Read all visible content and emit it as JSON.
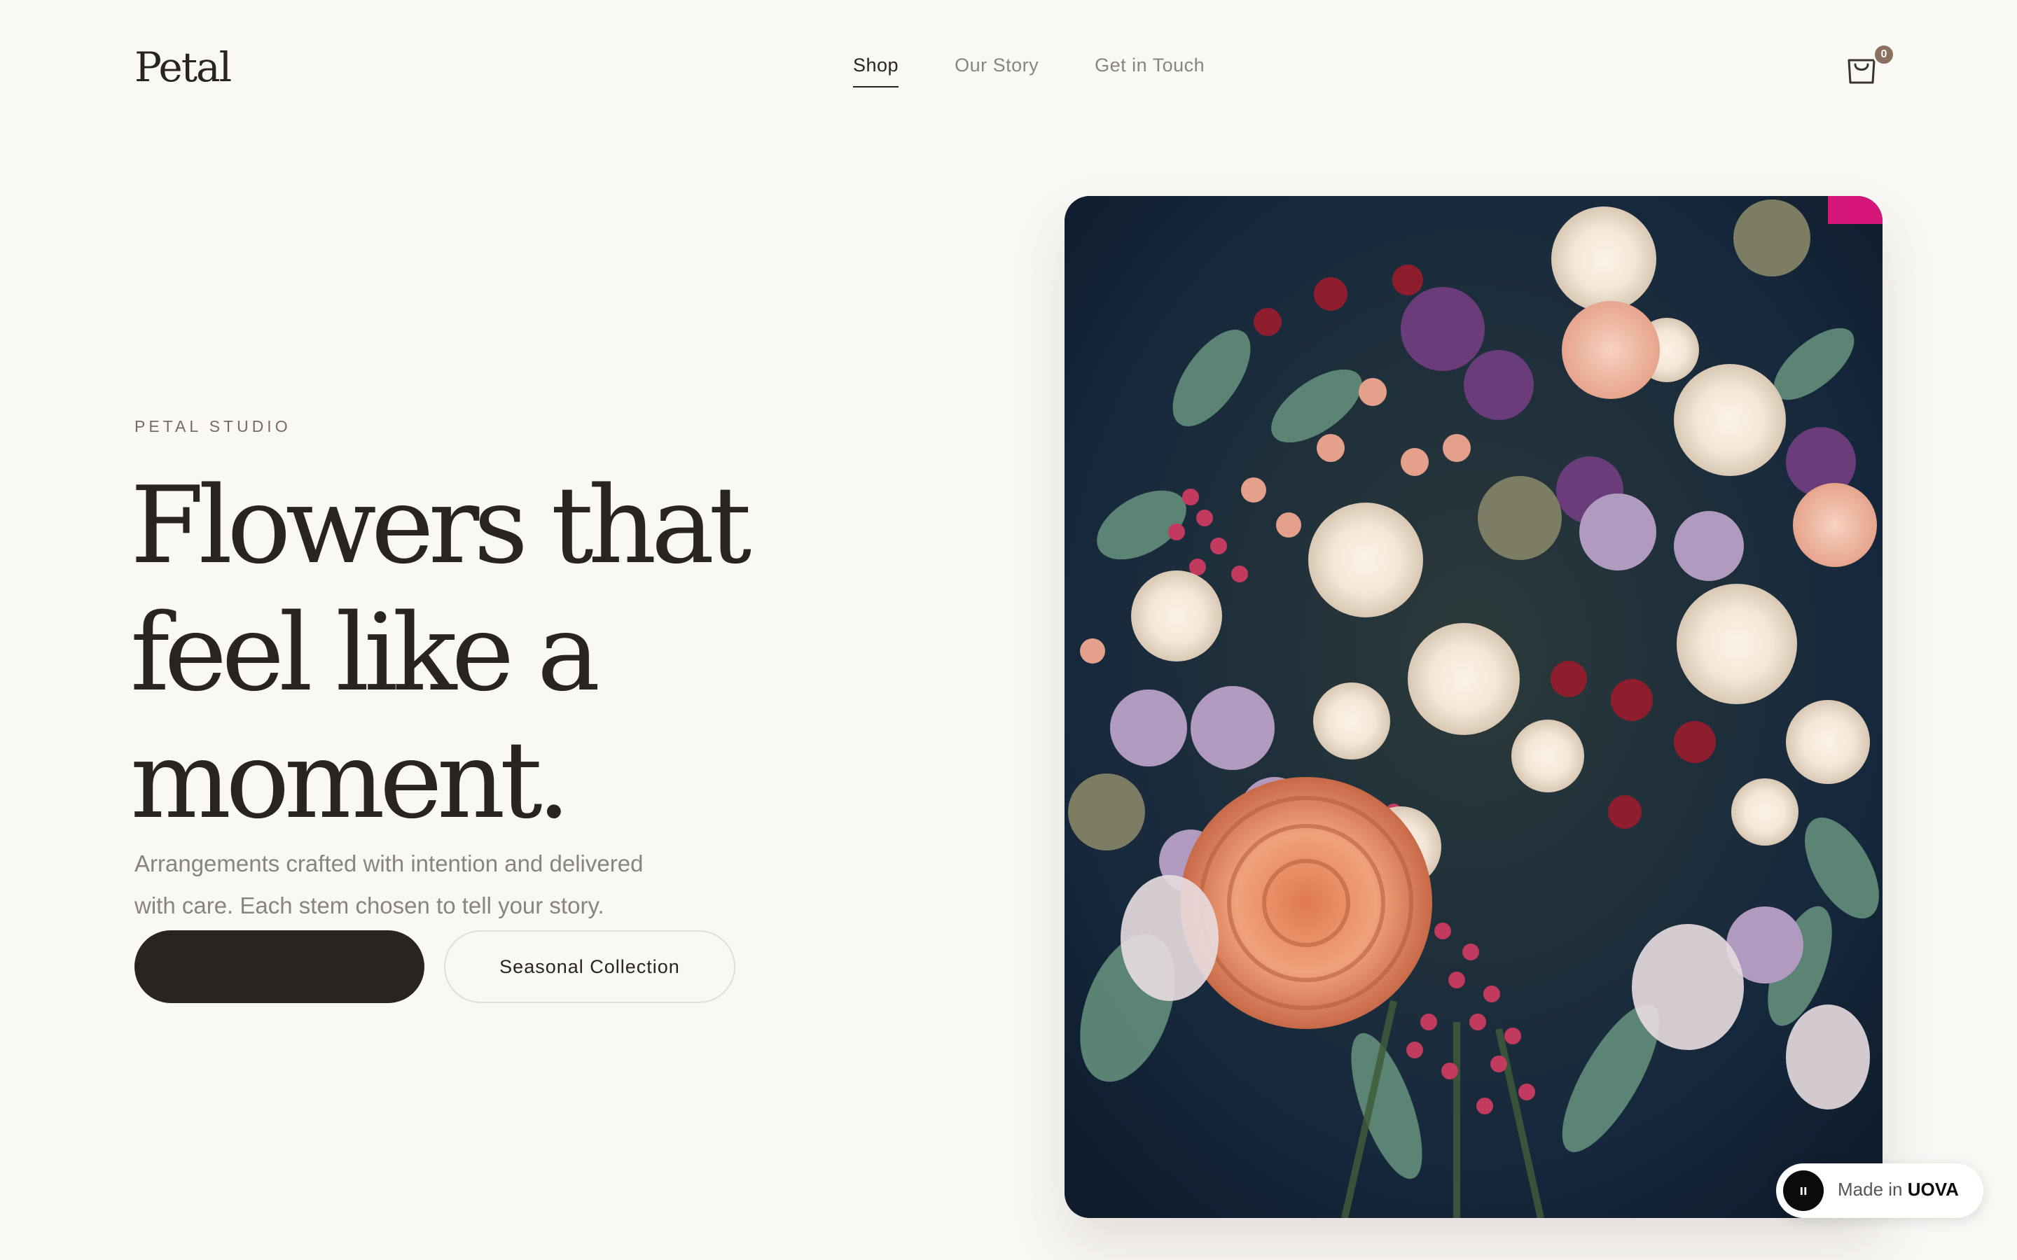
{
  "brand": {
    "logo": "Petal"
  },
  "nav": {
    "items": [
      {
        "label": "Shop",
        "active": true
      },
      {
        "label": "Our Story",
        "active": false
      },
      {
        "label": "Get in Touch",
        "active": false
      }
    ]
  },
  "cart": {
    "icon": "shopping-bag-icon",
    "count": "0"
  },
  "hero": {
    "eyebrow": "PETAL STUDIO",
    "headline_lines": [
      "Flowers that",
      "feel like a",
      "moment."
    ],
    "subtext_lines": [
      "Arrangements crafted with intention and delivered",
      "with care. Each stem chosen to tell your story."
    ],
    "primary_button_label": "",
    "secondary_button_label": "Seasonal Collection",
    "image": "flower-bouquet-photo"
  },
  "made_in": {
    "prefix": "Made in ",
    "brand": "UOVA",
    "logo_glyph": "ıı"
  },
  "colors": {
    "background": "#faf8f5",
    "text_dark": "#2a2421",
    "text_muted": "#8a8480",
    "accent": "#8b6f5f"
  }
}
